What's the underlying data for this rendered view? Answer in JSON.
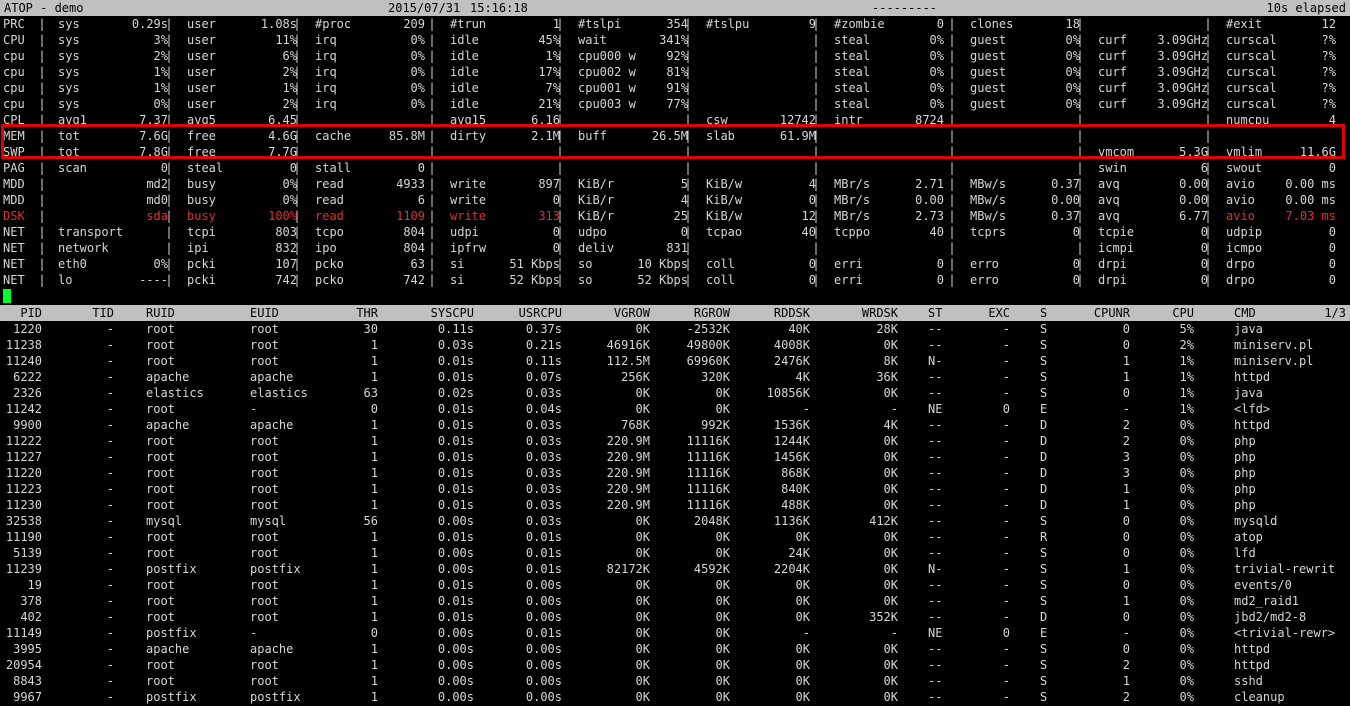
{
  "header": {
    "title": "ATOP - demo",
    "date": "2015/07/31",
    "time": "15:16:18",
    "dashes": "---------",
    "elapsed": "10s elapsed"
  },
  "sysrows": [
    {
      "label": "PRC",
      "red": false,
      "cells": [
        {
          "k": "sys",
          "v": "0.29s"
        },
        {
          "k": "user",
          "v": "1.08s"
        },
        {
          "k": "#proc",
          "v": "209"
        },
        {
          "k": "#trun",
          "v": "1"
        },
        {
          "k": "#tslpi",
          "v": "354"
        },
        {
          "k": "#tslpu",
          "v": "9"
        },
        {
          "k": "#zombie",
          "v": "0"
        },
        {
          "k": "clones",
          "v": "18"
        },
        {
          "k": "",
          "v": ""
        },
        {
          "k": "#exit",
          "v": "12"
        }
      ]
    },
    {
      "label": "CPU",
      "red": false,
      "cells": [
        {
          "k": "sys",
          "v": "3%"
        },
        {
          "k": "user",
          "v": "11%"
        },
        {
          "k": "irq",
          "v": "0%"
        },
        {
          "k": "idle",
          "v": "45%"
        },
        {
          "k": "wait",
          "v": "341%"
        },
        {
          "k": "",
          "v": ""
        },
        {
          "k": "steal",
          "v": "0%"
        },
        {
          "k": "guest",
          "v": "0%"
        },
        {
          "k": "curf",
          "v": "3.09GHz"
        },
        {
          "k": "curscal",
          "v": "?%"
        }
      ]
    },
    {
      "label": "cpu",
      "red": false,
      "cells": [
        {
          "k": "sys",
          "v": "2%"
        },
        {
          "k": "user",
          "v": "6%"
        },
        {
          "k": "irq",
          "v": "0%"
        },
        {
          "k": "idle",
          "v": "1%"
        },
        {
          "k": "cpu000 w",
          "v": "92%"
        },
        {
          "k": "",
          "v": ""
        },
        {
          "k": "steal",
          "v": "0%"
        },
        {
          "k": "guest",
          "v": "0%"
        },
        {
          "k": "curf",
          "v": "3.09GHz"
        },
        {
          "k": "curscal",
          "v": "?%"
        }
      ]
    },
    {
      "label": "cpu",
      "red": false,
      "cells": [
        {
          "k": "sys",
          "v": "1%"
        },
        {
          "k": "user",
          "v": "2%"
        },
        {
          "k": "irq",
          "v": "0%"
        },
        {
          "k": "idle",
          "v": "17%"
        },
        {
          "k": "cpu002 w",
          "v": "81%"
        },
        {
          "k": "",
          "v": ""
        },
        {
          "k": "steal",
          "v": "0%"
        },
        {
          "k": "guest",
          "v": "0%"
        },
        {
          "k": "curf",
          "v": "3.09GHz"
        },
        {
          "k": "curscal",
          "v": "?%"
        }
      ]
    },
    {
      "label": "cpu",
      "red": false,
      "cells": [
        {
          "k": "sys",
          "v": "1%"
        },
        {
          "k": "user",
          "v": "1%"
        },
        {
          "k": "irq",
          "v": "0%"
        },
        {
          "k": "idle",
          "v": "7%"
        },
        {
          "k": "cpu001 w",
          "v": "91%"
        },
        {
          "k": "",
          "v": ""
        },
        {
          "k": "steal",
          "v": "0%"
        },
        {
          "k": "guest",
          "v": "0%"
        },
        {
          "k": "curf",
          "v": "3.09GHz"
        },
        {
          "k": "curscal",
          "v": "?%"
        }
      ]
    },
    {
      "label": "cpu",
      "red": false,
      "cells": [
        {
          "k": "sys",
          "v": "0%"
        },
        {
          "k": "user",
          "v": "2%"
        },
        {
          "k": "irq",
          "v": "0%"
        },
        {
          "k": "idle",
          "v": "21%"
        },
        {
          "k": "cpu003 w",
          "v": "77%"
        },
        {
          "k": "",
          "v": ""
        },
        {
          "k": "steal",
          "v": "0%"
        },
        {
          "k": "guest",
          "v": "0%"
        },
        {
          "k": "curf",
          "v": "3.09GHz"
        },
        {
          "k": "curscal",
          "v": "?%"
        }
      ]
    },
    {
      "label": "CPL",
      "red": false,
      "cells": [
        {
          "k": "avg1",
          "v": "7.37"
        },
        {
          "k": "avg5",
          "v": "6.45"
        },
        {
          "k": "",
          "v": ""
        },
        {
          "k": "avg15",
          "v": "6.16"
        },
        {
          "k": "",
          "v": ""
        },
        {
          "k": "csw",
          "v": "12742"
        },
        {
          "k": "intr",
          "v": "8724"
        },
        {
          "k": "",
          "v": ""
        },
        {
          "k": "",
          "v": ""
        },
        {
          "k": "numcpu",
          "v": "4"
        }
      ]
    },
    {
      "label": "MEM",
      "red": false,
      "cells": [
        {
          "k": "tot",
          "v": "7.6G"
        },
        {
          "k": "free",
          "v": "4.6G"
        },
        {
          "k": "cache",
          "v": "85.8M"
        },
        {
          "k": "dirty",
          "v": "2.1M"
        },
        {
          "k": "buff",
          "v": "26.5M"
        },
        {
          "k": "slab",
          "v": "61.9M"
        },
        {
          "k": "",
          "v": ""
        },
        {
          "k": "",
          "v": ""
        },
        {
          "k": "",
          "v": ""
        },
        {
          "k": "",
          "v": ""
        }
      ]
    },
    {
      "label": "SWP",
      "red": false,
      "cells": [
        {
          "k": "tot",
          "v": "7.8G"
        },
        {
          "k": "free",
          "v": "7.7G"
        },
        {
          "k": "",
          "v": ""
        },
        {
          "k": "",
          "v": ""
        },
        {
          "k": "",
          "v": ""
        },
        {
          "k": "",
          "v": ""
        },
        {
          "k": "",
          "v": ""
        },
        {
          "k": "",
          "v": ""
        },
        {
          "k": "vmcom",
          "v": "5.3G"
        },
        {
          "k": "vmlim",
          "v": "11.6G"
        }
      ]
    },
    {
      "label": "PAG",
      "red": false,
      "cells": [
        {
          "k": "scan",
          "v": "0"
        },
        {
          "k": "steal",
          "v": "0"
        },
        {
          "k": "stall",
          "v": "0"
        },
        {
          "k": "",
          "v": ""
        },
        {
          "k": "",
          "v": ""
        },
        {
          "k": "",
          "v": ""
        },
        {
          "k": "",
          "v": ""
        },
        {
          "k": "",
          "v": ""
        },
        {
          "k": "swin",
          "v": "6"
        },
        {
          "k": "swout",
          "v": "0"
        }
      ]
    },
    {
      "label": "MDD",
      "red": false,
      "cells": [
        {
          "k": "",
          "v": "md2"
        },
        {
          "k": "busy",
          "v": "0%"
        },
        {
          "k": "read",
          "v": "4933"
        },
        {
          "k": "write",
          "v": "897"
        },
        {
          "k": "KiB/r",
          "v": "5"
        },
        {
          "k": "KiB/w",
          "v": "4"
        },
        {
          "k": "MBr/s",
          "v": "2.71"
        },
        {
          "k": "MBw/s",
          "v": "0.37"
        },
        {
          "k": "avq",
          "v": "0.00"
        },
        {
          "k": "avio",
          "v": "0.00 ms"
        }
      ]
    },
    {
      "label": "MDD",
      "red": false,
      "cells": [
        {
          "k": "",
          "v": "md0"
        },
        {
          "k": "busy",
          "v": "0%"
        },
        {
          "k": "read",
          "v": "6"
        },
        {
          "k": "write",
          "v": "0"
        },
        {
          "k": "KiB/r",
          "v": "4"
        },
        {
          "k": "KiB/w",
          "v": "0"
        },
        {
          "k": "MBr/s",
          "v": "0.00"
        },
        {
          "k": "MBw/s",
          "v": "0.00"
        },
        {
          "k": "avq",
          "v": "0.00"
        },
        {
          "k": "avio",
          "v": "0.00 ms"
        }
      ]
    },
    {
      "label": "DSK",
      "red": true,
      "cells": [
        {
          "k": "",
          "v": "sda",
          "red": true
        },
        {
          "k": "busy",
          "v": "100%",
          "red": true
        },
        {
          "k": "read",
          "v": "1109",
          "red": true
        },
        {
          "k": "write",
          "v": "313",
          "red": true
        },
        {
          "k": "KiB/r",
          "v": "25"
        },
        {
          "k": "KiB/w",
          "v": "12"
        },
        {
          "k": "MBr/s",
          "v": "2.73"
        },
        {
          "k": "MBw/s",
          "v": "0.37"
        },
        {
          "k": "avq",
          "v": "6.77"
        },
        {
          "k": "avio",
          "v": "7.03 ms",
          "red": true
        }
      ]
    },
    {
      "label": "NET",
      "red": false,
      "cells": [
        {
          "k": "transport",
          "v": ""
        },
        {
          "k": "tcpi",
          "v": "803"
        },
        {
          "k": "tcpo",
          "v": "804"
        },
        {
          "k": "udpi",
          "v": "0"
        },
        {
          "k": "udpo",
          "v": "0"
        },
        {
          "k": "tcpao",
          "v": "40"
        },
        {
          "k": "tcppo",
          "v": "40"
        },
        {
          "k": "tcprs",
          "v": "0"
        },
        {
          "k": "tcpie",
          "v": "0"
        },
        {
          "k": "udpip",
          "v": "0"
        }
      ]
    },
    {
      "label": "NET",
      "red": false,
      "cells": [
        {
          "k": "network",
          "v": ""
        },
        {
          "k": "ipi",
          "v": "832"
        },
        {
          "k": "ipo",
          "v": "804"
        },
        {
          "k": "ipfrw",
          "v": "0"
        },
        {
          "k": "deliv",
          "v": "831"
        },
        {
          "k": "",
          "v": ""
        },
        {
          "k": "",
          "v": ""
        },
        {
          "k": "",
          "v": ""
        },
        {
          "k": "icmpi",
          "v": "0"
        },
        {
          "k": "icmpo",
          "v": "0"
        }
      ]
    },
    {
      "label": "NET",
      "red": false,
      "cells": [
        {
          "k": "eth0",
          "v": "0%"
        },
        {
          "k": "pcki",
          "v": "107"
        },
        {
          "k": "pcko",
          "v": "63"
        },
        {
          "k": "si",
          "v": "51 Kbps"
        },
        {
          "k": "so",
          "v": "10 Kbps"
        },
        {
          "k": "coll",
          "v": "0"
        },
        {
          "k": "erri",
          "v": "0"
        },
        {
          "k": "erro",
          "v": "0"
        },
        {
          "k": "drpi",
          "v": "0"
        },
        {
          "k": "drpo",
          "v": "0"
        }
      ]
    },
    {
      "label": "NET",
      "red": false,
      "cells": [
        {
          "k": "lo",
          "v": "----"
        },
        {
          "k": "pcki",
          "v": "742"
        },
        {
          "k": "pcko",
          "v": "742"
        },
        {
          "k": "si",
          "v": "52 Kbps"
        },
        {
          "k": "so",
          "v": "52 Kbps"
        },
        {
          "k": "coll",
          "v": "0"
        },
        {
          "k": "erri",
          "v": "0"
        },
        {
          "k": "erro",
          "v": "0"
        },
        {
          "k": "drpi",
          "v": "0"
        },
        {
          "k": "drpo",
          "v": "0"
        }
      ]
    }
  ],
  "proc_headers": [
    "PID",
    "TID",
    "RUID",
    "EUID",
    "THR",
    "SYSCPU",
    "USRCPU",
    "VGROW",
    "RGROW",
    "RDDSK",
    "WRDSK",
    "ST",
    "EXC",
    "S",
    "CPUNR",
    "CPU",
    "CMD",
    "1/3"
  ],
  "procs": [
    [
      "1220",
      "-",
      "root",
      "root",
      "30",
      "0.11s",
      "0.37s",
      "0K",
      "-2532K",
      "40K",
      "28K",
      "--",
      "-",
      "S",
      "0",
      "5%",
      "java"
    ],
    [
      "11238",
      "-",
      "root",
      "root",
      "1",
      "0.03s",
      "0.21s",
      "46916K",
      "49800K",
      "4008K",
      "0K",
      "--",
      "-",
      "S",
      "0",
      "2%",
      "miniserv.pl"
    ],
    [
      "11240",
      "-",
      "root",
      "root",
      "1",
      "0.01s",
      "0.11s",
      "112.5M",
      "69960K",
      "2476K",
      "8K",
      "N-",
      "-",
      "S",
      "1",
      "1%",
      "miniserv.pl"
    ],
    [
      "6222",
      "-",
      "apache",
      "apache",
      "1",
      "0.01s",
      "0.07s",
      "256K",
      "320K",
      "4K",
      "36K",
      "--",
      "-",
      "S",
      "1",
      "1%",
      "httpd"
    ],
    [
      "2326",
      "-",
      "elastics",
      "elastics",
      "63",
      "0.02s",
      "0.03s",
      "0K",
      "0K",
      "10856K",
      "0K",
      "--",
      "-",
      "S",
      "0",
      "1%",
      "java"
    ],
    [
      "11242",
      "-",
      "root",
      "-",
      "0",
      "0.01s",
      "0.04s",
      "0K",
      "0K",
      "-",
      "-",
      "NE",
      "0",
      "E",
      "-",
      "1%",
      "<lfd>"
    ],
    [
      "9900",
      "-",
      "apache",
      "apache",
      "1",
      "0.01s",
      "0.03s",
      "768K",
      "992K",
      "1536K",
      "4K",
      "--",
      "-",
      "D",
      "2",
      "0%",
      "httpd"
    ],
    [
      "11222",
      "-",
      "root",
      "root",
      "1",
      "0.01s",
      "0.03s",
      "220.9M",
      "11116K",
      "1244K",
      "0K",
      "--",
      "-",
      "D",
      "2",
      "0%",
      "php"
    ],
    [
      "11227",
      "-",
      "root",
      "root",
      "1",
      "0.01s",
      "0.03s",
      "220.9M",
      "11116K",
      "1456K",
      "0K",
      "--",
      "-",
      "D",
      "3",
      "0%",
      "php"
    ],
    [
      "11220",
      "-",
      "root",
      "root",
      "1",
      "0.01s",
      "0.03s",
      "220.9M",
      "11116K",
      "868K",
      "0K",
      "--",
      "-",
      "D",
      "3",
      "0%",
      "php"
    ],
    [
      "11223",
      "-",
      "root",
      "root",
      "1",
      "0.01s",
      "0.03s",
      "220.9M",
      "11116K",
      "840K",
      "0K",
      "--",
      "-",
      "D",
      "1",
      "0%",
      "php"
    ],
    [
      "11230",
      "-",
      "root",
      "root",
      "1",
      "0.01s",
      "0.03s",
      "220.9M",
      "11116K",
      "488K",
      "0K",
      "--",
      "-",
      "D",
      "1",
      "0%",
      "php"
    ],
    [
      "32538",
      "-",
      "mysql",
      "mysql",
      "56",
      "0.00s",
      "0.03s",
      "0K",
      "2048K",
      "1136K",
      "412K",
      "--",
      "-",
      "S",
      "0",
      "0%",
      "mysqld"
    ],
    [
      "11190",
      "-",
      "root",
      "root",
      "1",
      "0.01s",
      "0.01s",
      "0K",
      "0K",
      "0K",
      "0K",
      "--",
      "-",
      "R",
      "0",
      "0%",
      "atop"
    ],
    [
      "5139",
      "-",
      "root",
      "root",
      "1",
      "0.00s",
      "0.01s",
      "0K",
      "0K",
      "24K",
      "0K",
      "--",
      "-",
      "S",
      "0",
      "0%",
      "lfd"
    ],
    [
      "11239",
      "-",
      "postfix",
      "postfix",
      "1",
      "0.00s",
      "0.01s",
      "82172K",
      "4592K",
      "2204K",
      "0K",
      "N-",
      "-",
      "S",
      "1",
      "0%",
      "trivial-rewrit"
    ],
    [
      "19",
      "-",
      "root",
      "root",
      "1",
      "0.01s",
      "0.00s",
      "0K",
      "0K",
      "0K",
      "0K",
      "--",
      "-",
      "S",
      "0",
      "0%",
      "events/0"
    ],
    [
      "378",
      "-",
      "root",
      "root",
      "1",
      "0.01s",
      "0.00s",
      "0K",
      "0K",
      "0K",
      "0K",
      "--",
      "-",
      "S",
      "1",
      "0%",
      "md2_raid1"
    ],
    [
      "402",
      "-",
      "root",
      "root",
      "1",
      "0.01s",
      "0.00s",
      "0K",
      "0K",
      "0K",
      "352K",
      "--",
      "-",
      "D",
      "0",
      "0%",
      "jbd2/md2-8"
    ],
    [
      "11149",
      "-",
      "postfix",
      "-",
      "0",
      "0.00s",
      "0.01s",
      "0K",
      "0K",
      "-",
      "-",
      "NE",
      "0",
      "E",
      "-",
      "0%",
      "<trivial-rewr>"
    ],
    [
      "3995",
      "-",
      "apache",
      "apache",
      "1",
      "0.00s",
      "0.00s",
      "0K",
      "0K",
      "0K",
      "0K",
      "--",
      "-",
      "S",
      "0",
      "0%",
      "httpd"
    ],
    [
      "20954",
      "-",
      "root",
      "root",
      "1",
      "0.00s",
      "0.00s",
      "0K",
      "0K",
      "0K",
      "0K",
      "--",
      "-",
      "S",
      "2",
      "0%",
      "httpd"
    ],
    [
      "8843",
      "-",
      "root",
      "root",
      "1",
      "0.00s",
      "0.00s",
      "0K",
      "0K",
      "0K",
      "0K",
      "--",
      "-",
      "S",
      "1",
      "0%",
      "sshd"
    ],
    [
      "9967",
      "-",
      "postfix",
      "postfix",
      "1",
      "0.00s",
      "0.00s",
      "0K",
      "0K",
      "0K",
      "0K",
      "--",
      "-",
      "S",
      "2",
      "0%",
      "cleanup"
    ]
  ]
}
